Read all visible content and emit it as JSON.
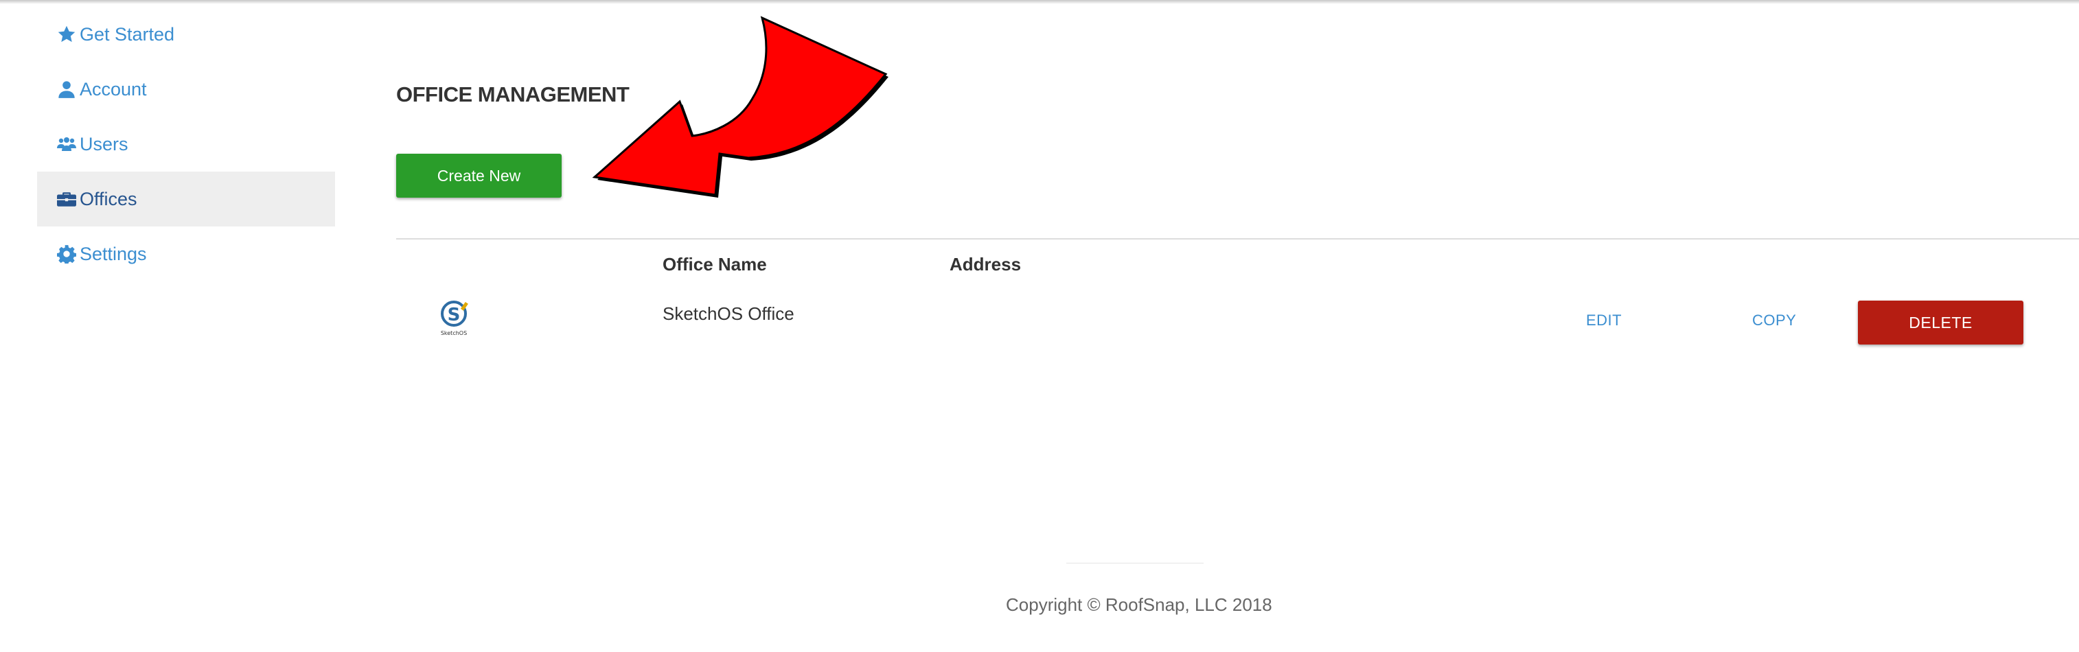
{
  "sidebar": {
    "items": [
      {
        "label": "Get Started",
        "icon": "star-icon",
        "active": false
      },
      {
        "label": "Account",
        "icon": "user-icon",
        "active": false
      },
      {
        "label": "Users",
        "icon": "users-icon",
        "active": false
      },
      {
        "label": "Offices",
        "icon": "briefcase-icon",
        "active": true
      },
      {
        "label": "Settings",
        "icon": "gear-icon",
        "active": false
      }
    ]
  },
  "main": {
    "title": "OFFICE MANAGEMENT",
    "create_button": "Create New",
    "table": {
      "columns": [
        "Office Name",
        "Address"
      ],
      "rows": [
        {
          "logo_text": "SketchOS",
          "office_name": "SketchOS Office",
          "address": "",
          "edit": "EDIT",
          "copy": "COPY",
          "delete": "DELETE"
        }
      ]
    }
  },
  "footer": {
    "copyright": "Copyright © RoofSnap, LLC 2018"
  },
  "colors": {
    "link": "#3b8ed0",
    "active_nav": "#27558f",
    "create": "#2a9d2a",
    "delete": "#b51d12",
    "arrow": "#ff0000"
  }
}
